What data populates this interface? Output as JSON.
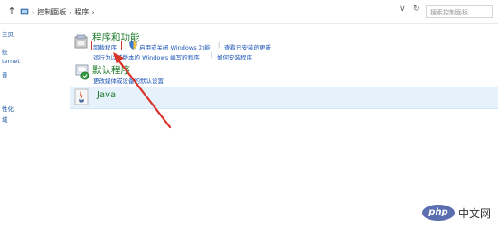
{
  "address_bar": {
    "up_glyph": "↑",
    "breadcrumb": [
      "控制面板",
      "程序"
    ],
    "separator": "›",
    "dropdown_glyph": "∨",
    "refresh_glyph": "↻",
    "search_placeholder": "搜索控制面板"
  },
  "sidebar": {
    "items": [
      "主页",
      "统",
      "ternet",
      "音",
      "性化",
      "域"
    ]
  },
  "programs": {
    "title": "程序和功能",
    "links_row1": [
      "卸载程序",
      "启用或关闭 Windows 功能",
      "查看已安装的更新"
    ],
    "links_row2": [
      "运行为以前版本的 Windows 编写的程序",
      "如何安装程序"
    ]
  },
  "default_programs": {
    "title": "默认程序",
    "links": [
      "更改媒体或设备的默认设置"
    ]
  },
  "java": {
    "title": "Java"
  },
  "watermark": {
    "logo": "php",
    "text": "中文网"
  },
  "colors": {
    "group_title": "#1e7b2b",
    "link": "#1a55b8",
    "highlight": "#d9332b",
    "selected_row": "#e5f1fb"
  }
}
